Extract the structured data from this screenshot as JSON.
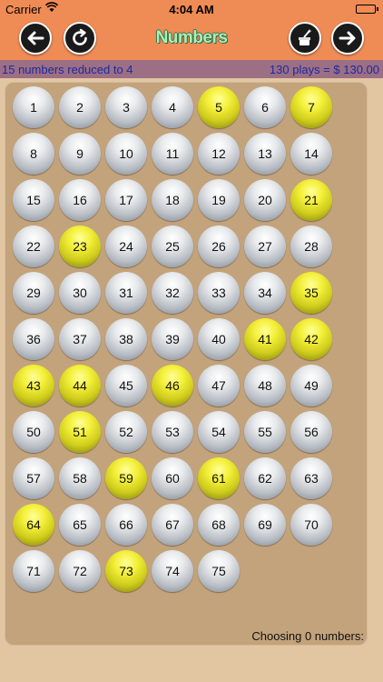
{
  "status_bar": {
    "carrier": "Carrier",
    "time": "4:04 AM"
  },
  "nav": {
    "title": "Numbers"
  },
  "info": {
    "left": "15 numbers reduced to 4",
    "right": "130 plays = $ 130.00"
  },
  "colors": {
    "accent": "#ef8b55",
    "selected": "#f4f03a",
    "info_text": "#1a2aa0"
  },
  "balls": [
    1,
    2,
    3,
    4,
    5,
    6,
    7,
    8,
    9,
    10,
    11,
    12,
    13,
    14,
    15,
    16,
    17,
    18,
    19,
    20,
    21,
    22,
    23,
    24,
    25,
    26,
    27,
    28,
    29,
    30,
    31,
    32,
    33,
    34,
    35,
    36,
    37,
    38,
    39,
    40,
    41,
    42,
    43,
    44,
    45,
    46,
    47,
    48,
    49,
    50,
    51,
    52,
    53,
    54,
    55,
    56,
    57,
    58,
    59,
    60,
    61,
    62,
    63,
    64,
    65,
    66,
    67,
    68,
    69,
    70,
    71,
    72,
    73,
    74,
    75
  ],
  "selected": [
    5,
    7,
    21,
    23,
    35,
    41,
    42,
    43,
    44,
    46,
    51,
    59,
    61,
    64,
    73
  ],
  "footer": {
    "text": "Choosing 0 numbers:"
  }
}
